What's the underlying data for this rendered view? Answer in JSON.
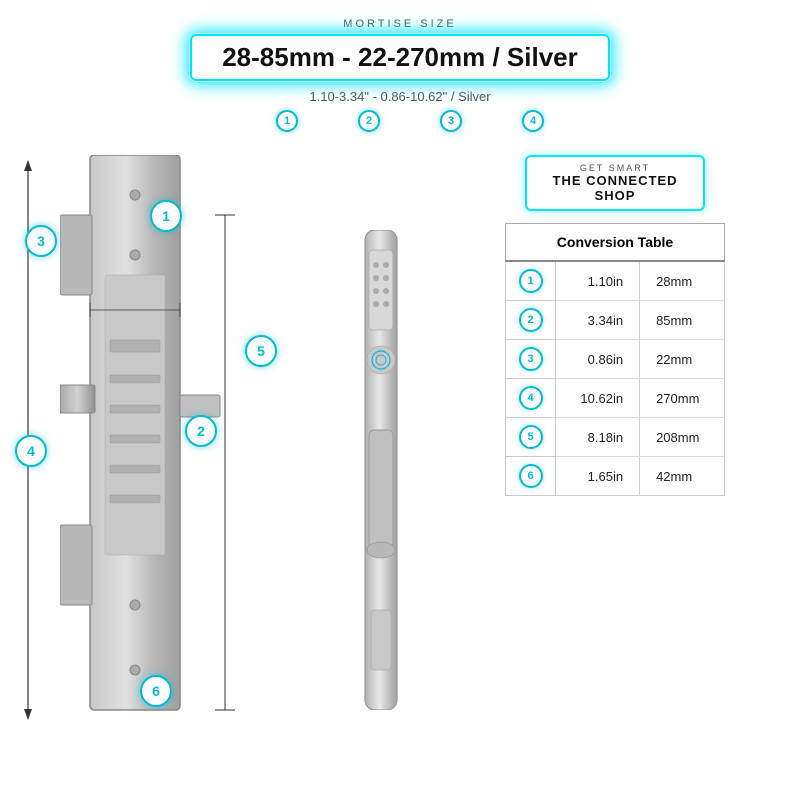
{
  "header": {
    "mortise_label": "MORTISE SIZE",
    "main_title": "28-85mm - 22-270mm / Silver",
    "subtitle": "1.10-3.34\" - 0.86-10.62\" / Silver",
    "markers": [
      1,
      2,
      3,
      4
    ]
  },
  "brand": {
    "get_smart": "GET SMART",
    "name": "THE CONNECTED SHOP"
  },
  "conversion_table": {
    "header": "Conversion Table",
    "rows": [
      {
        "num": 1,
        "inches": "1.10in",
        "mm": "28mm"
      },
      {
        "num": 2,
        "inches": "3.34in",
        "mm": "85mm"
      },
      {
        "num": 3,
        "inches": "0.86in",
        "mm": "22mm"
      },
      {
        "num": 4,
        "inches": "10.62in",
        "mm": "270mm"
      },
      {
        "num": 5,
        "inches": "8.18in",
        "mm": "208mm"
      },
      {
        "num": 6,
        "inches": "1.65in",
        "mm": "42mm"
      }
    ]
  },
  "diagram_circles": [
    {
      "num": 1,
      "label": "1"
    },
    {
      "num": 2,
      "label": "2"
    },
    {
      "num": 3,
      "label": "3"
    },
    {
      "num": 4,
      "label": "4"
    },
    {
      "num": 5,
      "label": "5"
    },
    {
      "num": 6,
      "label": "6"
    }
  ]
}
